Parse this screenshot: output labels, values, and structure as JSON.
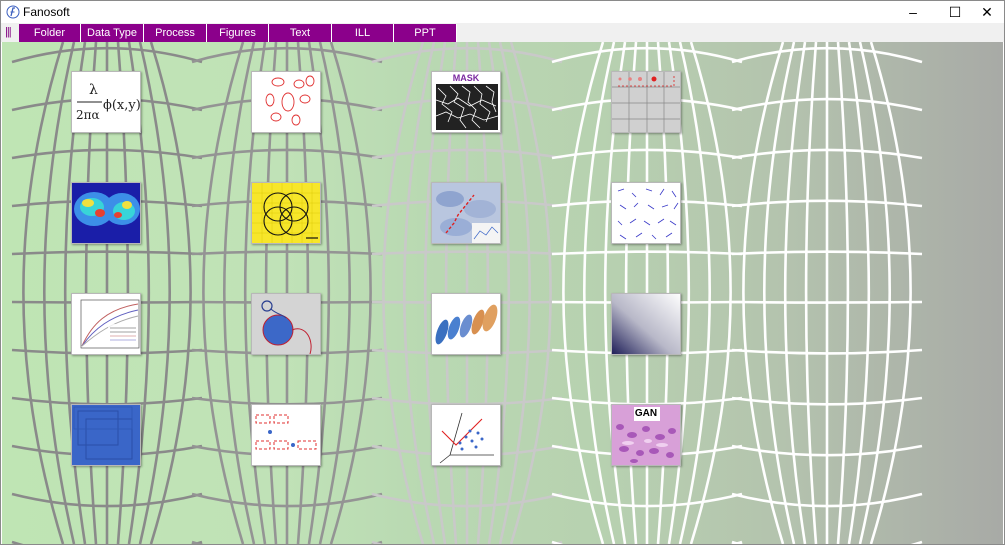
{
  "window": {
    "title": "Fanosoft",
    "minimize_glyph": "–",
    "maximize_glyph": "☐",
    "close_glyph": "✕"
  },
  "menu": {
    "grip_glyph": "|||",
    "items": [
      "Folder",
      "Data Type",
      "Process",
      "Figures",
      "Text",
      "ILL",
      "PPT"
    ]
  },
  "thumbnails": {
    "mask_label": "MASK",
    "gan_label": "GAN"
  },
  "colors": {
    "menu_bg": "#8b008b",
    "menu_text": "#ffffff",
    "grid_left": "#8a8a8a",
    "grid_right": "#ffffff"
  }
}
